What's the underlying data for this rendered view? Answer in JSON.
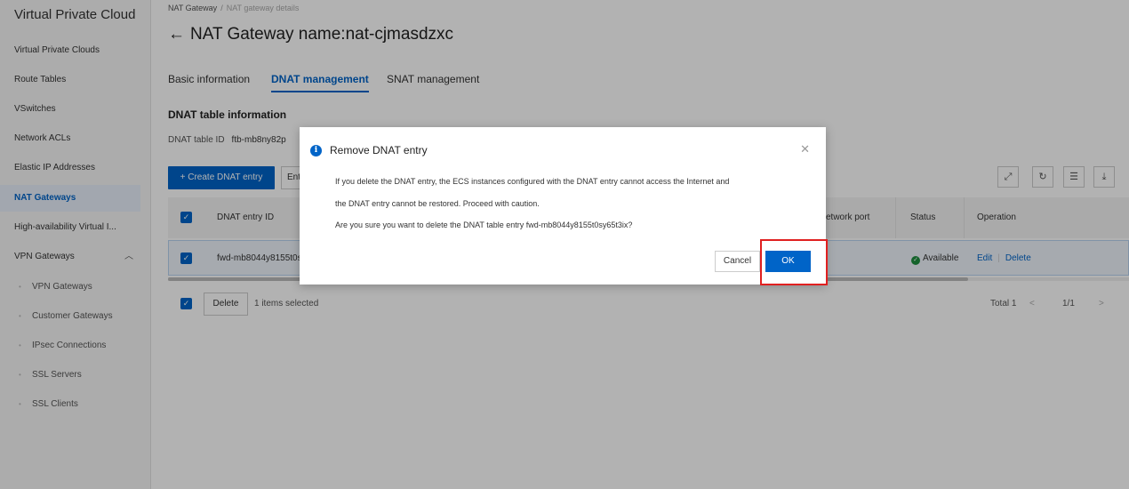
{
  "sidebar": {
    "title": "Virtual Private Cloud",
    "items": [
      {
        "label": "Virtual Private Clouds"
      },
      {
        "label": "Route Tables"
      },
      {
        "label": "VSwitches"
      },
      {
        "label": "Network ACLs"
      },
      {
        "label": "Elastic IP Addresses"
      },
      {
        "label": "NAT Gateways",
        "active": true
      },
      {
        "label": "High-availability Virtual I..."
      },
      {
        "label": "VPN Gateways",
        "expanded": true
      },
      {
        "label": "VPN Gateways"
      },
      {
        "label": "Customer Gateways"
      },
      {
        "label": "IPsec Connections"
      },
      {
        "label": "SSL Servers"
      },
      {
        "label": "SSL Clients"
      }
    ]
  },
  "breadcrumb": {
    "parent": "NAT Gateway",
    "separator": "/",
    "current": "NAT gateway details"
  },
  "page": {
    "back_arrow": "←",
    "title": "NAT Gateway name:nat-cjmasdzxc"
  },
  "tabs": [
    {
      "label": "Basic information"
    },
    {
      "label": "DNAT management",
      "active": true
    },
    {
      "label": "SNAT management"
    }
  ],
  "section": {
    "title": "DNAT table information",
    "table_id_label": "DNAT table ID",
    "table_id_value": "ftb-mb8ny82p"
  },
  "toolbar": {
    "create_label": "+ Create DNAT entry",
    "entry_button_label": "Ent"
  },
  "table": {
    "headers": [
      "DNAT entry ID",
      "etwork port",
      "Status",
      "Operation"
    ],
    "rows": [
      {
        "id": "fwd-mb8044y8155t0s",
        "status": "Available",
        "edit": "Edit",
        "delete": "Delete"
      }
    ]
  },
  "footer": {
    "delete_label": "Delete",
    "selected_text": "1 items selected",
    "total": "Total 1",
    "page": "1/1"
  },
  "modal": {
    "title": "Remove DNAT entry",
    "line1": "If you delete the DNAT entry, the ECS instances configured with the DNAT entry cannot access the Internet and",
    "line2": "the DNAT entry cannot be restored. Proceed with caution.",
    "line3": "Are you sure you want to delete the DNAT table entry fwd-mb8044y8155t0sy65t3ix?",
    "cancel_label": "Cancel",
    "ok_label": "OK"
  },
  "colors": {
    "accent": "#0064c8",
    "highlight": "#e02020",
    "status_ok": "#1e8e3e"
  }
}
